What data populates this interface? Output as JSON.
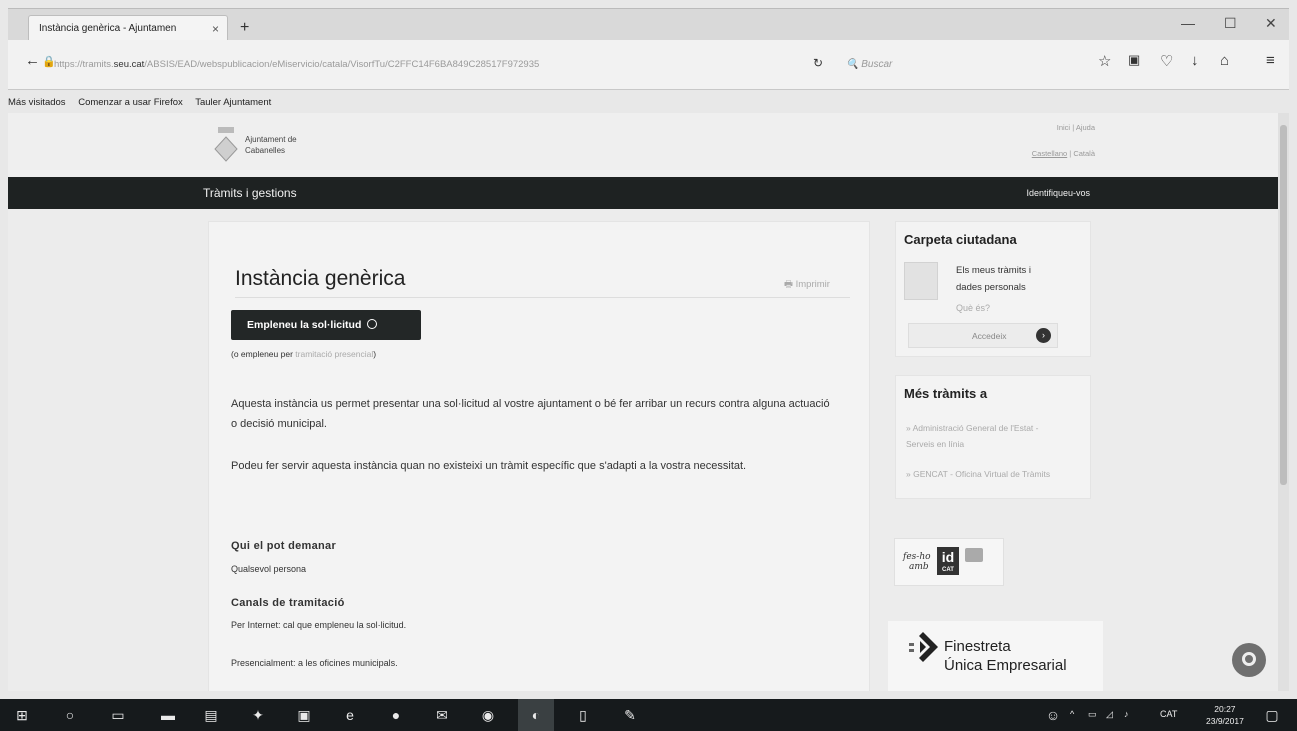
{
  "browser": {
    "tab_title": "Instància genèrica - Ajuntamen",
    "tab_close": "×",
    "new_tab": "+",
    "url_prefix": "https://tramits.",
    "url_domain": "seu.cat",
    "url_path": "/ABSIS/EAD/webspublicacion/eMiservicio/catala/VisorfTu/C2FFC14F6BA849C28517F972935",
    "search_placeholder": "Buscar",
    "bookmarks": [
      "Más visitados",
      "Comenzar a usar Firefox",
      "Tauler Ajuntament"
    ]
  },
  "site": {
    "org_line1": "Ajuntament de",
    "org_line2": "Cabanelles",
    "inici": "Inici",
    "ajuda": "Ajuda",
    "castellano": "Castellano",
    "catala": "Català",
    "nav_left": "Tràmits i gestions",
    "nav_right": "Identifiqueu-vos"
  },
  "main": {
    "title": "Instància genèrica",
    "print": "Imprimir",
    "fill_button": "Empleneu la sol·licitud",
    "alt_prefix": "(o empleneu per",
    "alt_link": "tramitació presencial",
    "alt_suffix": ")",
    "para1": "Aquesta instància us permet presentar una sol·licitud al vostre ajuntament o bé fer arribar un recurs contra alguna actuació o decisió municipal.",
    "para2": "Podeu fer servir aquesta instància quan no existeixi un tràmit específic que s'adapti a la vostra necessitat.",
    "who_heading": "Qui el pot demanar",
    "who_text": "Qualsevol persona",
    "channels_heading": "Canals de tramitació",
    "channel_internet": "Per Internet: cal que empleneu la sol·licitud.",
    "channel_presencial": "Presencialment: a les oficines municipals."
  },
  "sidebar": {
    "carpeta_title": "Carpeta ciutadana",
    "carpeta_line1": "Els meus tràmits i",
    "carpeta_line2": "dades personals",
    "que_es": "Què és?",
    "access_button": "Accedeix",
    "more_title": "Més tràmits a",
    "more_links": [
      "» Administració General de l'Estat - Serveis en línia",
      "» GENCAT - Oficina Virtual de Tràmits"
    ],
    "fesho_line1": "fes-ho",
    "fesho_line2": "amb",
    "idcat_id": "id",
    "idcat_cat": "CAT",
    "fue_line1": "Finestreta",
    "fue_line2": "Única Empresarial"
  },
  "taskbar": {
    "lang": "CAT",
    "time": "20:27",
    "date": "23/9/2017"
  }
}
